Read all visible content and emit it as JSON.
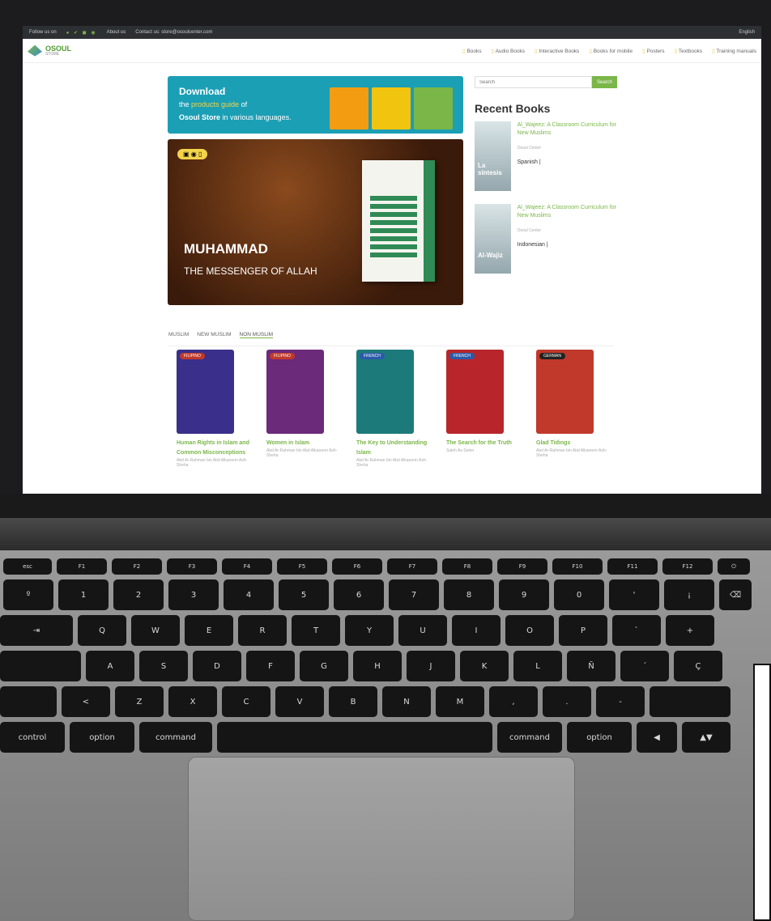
{
  "topbar": {
    "follow": "Follow us on",
    "about": "About us",
    "contact": "Contact us: store@osoulcenter.com",
    "lang": "English"
  },
  "logo": {
    "name": "OSOUL",
    "sub": "STORE"
  },
  "menu": [
    "Books",
    "Audio Books",
    "Interactive Books",
    "Books for mobile",
    "Posters",
    "Textbooks",
    "Training manuals"
  ],
  "banner": {
    "line1": "Download",
    "line2_pre": "the ",
    "line2_hl": "products guide",
    "line2_post": " of",
    "line3_b": "Osoul Store",
    "line3_post": " in various languages."
  },
  "slider": {
    "title": "MUHAMMAD",
    "subtitle": "THE MESSENGER OF ALLAH"
  },
  "search": {
    "placeholder": "Search",
    "button": "Search"
  },
  "recent": {
    "title": "Recent Books",
    "items": [
      {
        "thumb": "La síntesis",
        "title": "Al_Wajeez: A Classroom Curriculum for New Muslims",
        "author": "Osoul Center",
        "lang": "Spanish |"
      },
      {
        "thumb": "Al-Wajiz",
        "title": "Al_Wajeez: A Classroom Curriculum for New Muslims",
        "author": "Osoul Center",
        "lang": "Indonesian |"
      }
    ]
  },
  "tabs": [
    "MUSLIM",
    "NEW MUSLIM",
    "NON MUSLIM"
  ],
  "books": [
    {
      "lang": "FILIPINO",
      "title": "Human Rights in Islam and Common Misconceptions",
      "author": "Abd Ar-Rahman bin Abd Alkareem Ash-Sheha",
      "color": "#3a2f8a"
    },
    {
      "lang": "FILIPINO",
      "title": "Women in Islam",
      "author": "Abd Ar-Rahman bin Abd Alkareem Ash-Sheha",
      "color": "#6c2a7a"
    },
    {
      "lang": "FRENCH",
      "title": "The Key to Understanding Islam",
      "author": "Abd Ar-Rahman bin Abd Alkareem Ash-Sheha",
      "color": "#1d7a7a"
    },
    {
      "lang": "FRENCH",
      "title": "The Search for the Truth",
      "author": "Saleh As-Selen",
      "color": "#b8262c"
    },
    {
      "lang": "GERMAN",
      "title": "Glad Tidings",
      "author": "Abd Ar-Rahman bin Abd Alkareem Ash-Sheha",
      "color": "#c0392b"
    }
  ]
}
